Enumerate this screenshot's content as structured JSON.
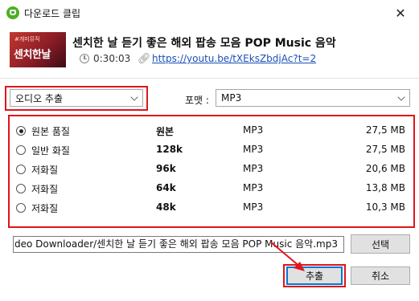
{
  "window": {
    "title": "다운로드 클립",
    "close_glyph": "✕"
  },
  "video": {
    "thumbnail_tag": "#개미뮤직",
    "thumbnail_text": "센치한날",
    "title": "센치한 날 듣기 좋은 해외 팝송 모음 POP Music 음악",
    "duration": "0:30:03",
    "url": "https://youtu.be/tXEksZbdjAc?t=2"
  },
  "extract_mode": {
    "selected": "오디오 추출"
  },
  "format": {
    "label": "포맷 :",
    "selected": "MP3"
  },
  "qualities": [
    {
      "label": "원본 품질",
      "quality": "원본",
      "format": "MP3",
      "size": "27,5 MB",
      "checked": true
    },
    {
      "label": "일반 화질",
      "quality": "128k",
      "format": "MP3",
      "size": "27,5 MB",
      "checked": false
    },
    {
      "label": "저화질",
      "quality": "96k",
      "format": "MP3",
      "size": "20,6 MB",
      "checked": false
    },
    {
      "label": "저화질",
      "quality": "64k",
      "format": "MP3",
      "size": "13,8 MB",
      "checked": false
    },
    {
      "label": "저화질",
      "quality": "48k",
      "format": "MP3",
      "size": "10,3 MB",
      "checked": false
    }
  ],
  "save_path": "deo Downloader/센치한 날 듣기 좋은 해외 팝송 모음 POP Music 음악.mp3",
  "buttons": {
    "browse": "선택",
    "extract": "추출",
    "cancel": "취소"
  },
  "colors": {
    "highlight": "#e0151a",
    "link": "#1a4fb8",
    "app_icon": "#4caf24"
  }
}
